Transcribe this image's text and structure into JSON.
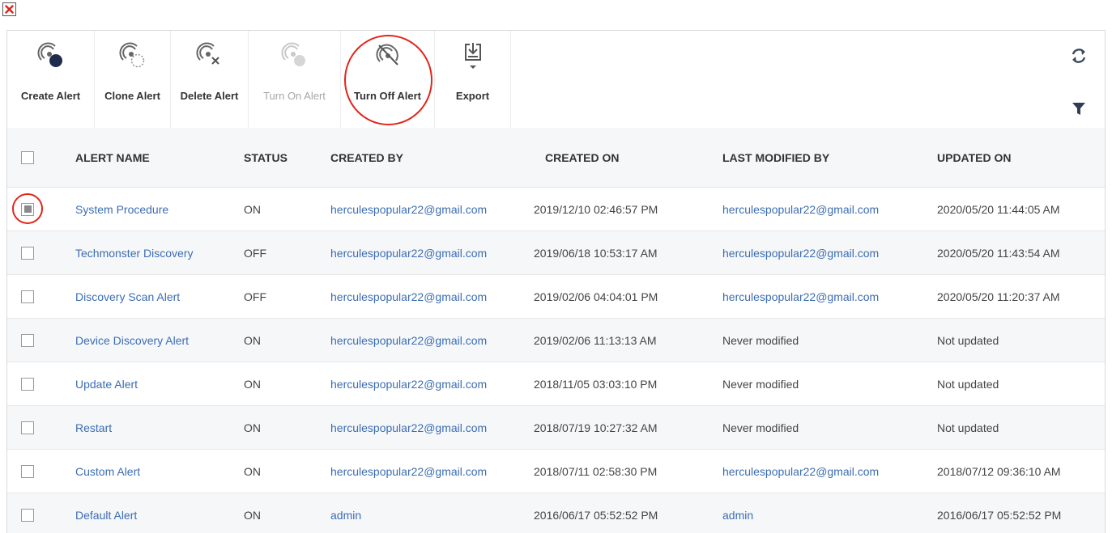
{
  "window": {
    "close_icon": "close-x-icon",
    "close_color": "#d9261c"
  },
  "toolbar": {
    "buttons": [
      {
        "label": "Create Alert",
        "icon": "create-alert-icon",
        "enabled": true
      },
      {
        "label": "Clone Alert",
        "icon": "clone-alert-icon",
        "enabled": true
      },
      {
        "label": "Delete Alert",
        "icon": "delete-alert-icon",
        "enabled": true
      },
      {
        "label": "Turn On Alert",
        "icon": "turn-on-alert-icon",
        "enabled": false
      },
      {
        "label": "Turn Off Alert",
        "icon": "turn-off-alert-icon",
        "enabled": true,
        "highlighted": true
      },
      {
        "label": "Export",
        "icon": "export-icon",
        "enabled": true,
        "has_dropdown": true
      }
    ],
    "right_icons": [
      "refresh-icon",
      "filter-icon"
    ]
  },
  "table": {
    "columns": [
      "ALERT NAME",
      "STATUS",
      "CREATED BY",
      "CREATED ON",
      "LAST MODIFIED BY",
      "UPDATED ON"
    ],
    "rows": [
      {
        "checked": true,
        "name": "System Procedure",
        "status": "ON",
        "created_by": "herculespopular22@gmail.com",
        "created_on": "2019/12/10 02:46:57 PM",
        "modified_by": "herculespopular22@gmail.com",
        "modified_is_link": true,
        "updated_on": "2020/05/20 11:44:05 AM"
      },
      {
        "checked": false,
        "name": "Techmonster Discovery",
        "status": "OFF",
        "created_by": "herculespopular22@gmail.com",
        "created_on": "2019/06/18 10:53:17 AM",
        "modified_by": "herculespopular22@gmail.com",
        "modified_is_link": true,
        "updated_on": "2020/05/20 11:43:54 AM"
      },
      {
        "checked": false,
        "name": "Discovery Scan Alert",
        "status": "OFF",
        "created_by": "herculespopular22@gmail.com",
        "created_on": "2019/02/06 04:04:01 PM",
        "modified_by": "herculespopular22@gmail.com",
        "modified_is_link": true,
        "updated_on": "2020/05/20 11:20:37 AM"
      },
      {
        "checked": false,
        "name": "Device Discovery Alert",
        "status": "ON",
        "created_by": "herculespopular22@gmail.com",
        "created_on": "2019/02/06 11:13:13 AM",
        "modified_by": "Never modified",
        "modified_is_link": false,
        "updated_on": "Not updated"
      },
      {
        "checked": false,
        "name": "Update Alert",
        "status": "ON",
        "created_by": "herculespopular22@gmail.com",
        "created_on": "2018/11/05 03:03:10 PM",
        "modified_by": "Never modified",
        "modified_is_link": false,
        "updated_on": "Not updated"
      },
      {
        "checked": false,
        "name": "Restart",
        "status": "ON",
        "created_by": "herculespopular22@gmail.com",
        "created_on": "2018/07/19 10:27:32 AM",
        "modified_by": "Never modified",
        "modified_is_link": false,
        "updated_on": "Not updated"
      },
      {
        "checked": false,
        "name": "Custom Alert",
        "status": "ON",
        "created_by": "herculespopular22@gmail.com",
        "created_on": "2018/07/11 02:58:30 PM",
        "modified_by": "herculespopular22@gmail.com",
        "modified_is_link": true,
        "updated_on": "2018/07/12 09:36:10 AM"
      },
      {
        "checked": false,
        "name": "Default Alert",
        "status": "ON",
        "created_by": "admin",
        "created_on": "2016/06/17 05:52:52 PM",
        "modified_by": "admin",
        "modified_is_link": true,
        "updated_on": "2016/06/17 05:52:52 PM"
      }
    ]
  },
  "colors": {
    "link": "#3b6db3",
    "highlight_circle": "#e0261b",
    "header_bg": "#f6f7f9",
    "disabled_text": "#a6a6a6"
  }
}
